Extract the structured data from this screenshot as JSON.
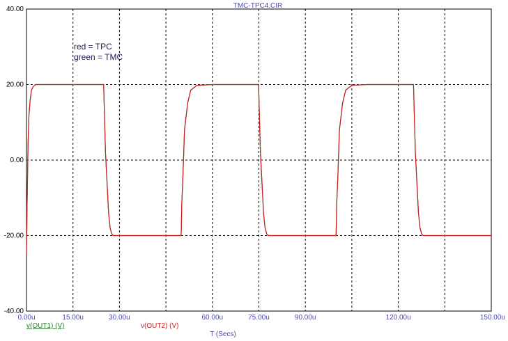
{
  "chart_data": {
    "type": "line",
    "title": "TMC-TPC4.CIR",
    "xlabel": "T (Secs)",
    "ylabel": "",
    "xlim": [
      0,
      150
    ],
    "ylim": [
      -40,
      40
    ],
    "x_ticks": [
      0,
      15,
      30,
      45,
      60,
      75,
      90,
      105,
      120,
      135,
      150
    ],
    "x_tick_labels": [
      "0.00u",
      "15.00u",
      "30.00u",
      "",
      "60.00u",
      "75.00u",
      "90.00u",
      "",
      "120.00u",
      "",
      "150.00u"
    ],
    "y_ticks": [
      -40,
      -20,
      0,
      20,
      40
    ],
    "y_tick_labels": [
      "-40.00",
      "-20.00",
      "0.00",
      "20.00",
      "40.00"
    ],
    "grid": true,
    "annotations": [
      "red = TPC",
      "green = TMC"
    ],
    "series": [
      {
        "name": "v(OUT1) (V)",
        "color": "#2a7a2a",
        "x": [
          0,
          0.2,
          0.5,
          0.8,
          1.2,
          1.6,
          2.2,
          3,
          5,
          10,
          20,
          24.9,
          25.0,
          25.1,
          25.5,
          26,
          26.5,
          27,
          27.5,
          28,
          30,
          40,
          49.9,
          50.0,
          50.1,
          50.5,
          51,
          52,
          53,
          55,
          60,
          70,
          74.9,
          75.0,
          75.1,
          75.5,
          76,
          76.5,
          77,
          77.5,
          78,
          80,
          90,
          99.9,
          100.0,
          100.1,
          100.5,
          101,
          102,
          103,
          105,
          110,
          120,
          124.9,
          125.0,
          125.1,
          125.5,
          126,
          126.5,
          127,
          127.5,
          128,
          130,
          140,
          150
        ],
        "y": [
          -25,
          -12,
          4,
          12,
          16,
          18.5,
          19.5,
          20,
          20,
          20,
          20,
          20,
          17,
          14,
          2,
          -6,
          -14,
          -18,
          -19.5,
          -20,
          -20,
          -20,
          -20,
          -17,
          -12,
          -4,
          8,
          15,
          18.5,
          19.8,
          20,
          20,
          20,
          17,
          14,
          2,
          -6,
          -14,
          -18,
          -19.5,
          -20,
          -20,
          -20,
          -20,
          -17,
          -12,
          -4,
          8,
          15,
          18.5,
          19.8,
          20,
          20,
          20,
          17,
          14,
          2,
          -6,
          -14,
          -18,
          -19.5,
          -20,
          -20,
          -20,
          -20
        ]
      },
      {
        "name": "v(OUT2) (V)",
        "color": "#cc2020",
        "x": [
          0,
          0.2,
          0.5,
          0.8,
          1.2,
          1.6,
          2.2,
          3,
          5,
          10,
          20,
          24.9,
          25.0,
          25.1,
          25.5,
          26,
          26.5,
          27,
          27.5,
          28,
          30,
          40,
          49.9,
          50.0,
          50.1,
          50.5,
          51,
          52,
          53,
          55,
          60,
          70,
          74.9,
          75.0,
          75.1,
          75.5,
          76,
          76.5,
          77,
          77.5,
          78,
          80,
          90,
          99.9,
          100.0,
          100.1,
          100.5,
          101,
          102,
          103,
          105,
          110,
          120,
          124.9,
          125.0,
          125.1,
          125.5,
          126,
          126.5,
          127,
          127.5,
          128,
          130,
          140,
          150
        ],
        "y": [
          -25,
          -12,
          4,
          12,
          16,
          18.5,
          19.5,
          20,
          20,
          20,
          20,
          20,
          17,
          14,
          2,
          -6,
          -14,
          -18,
          -19.5,
          -20,
          -20,
          -20,
          -20,
          -17,
          -12,
          -4,
          8,
          15,
          18.5,
          19.8,
          20,
          20,
          20,
          17,
          14,
          2,
          -6,
          -14,
          -18,
          -19.5,
          -20,
          -20,
          -20,
          -20,
          -17,
          -12,
          -4,
          8,
          15,
          18.5,
          19.8,
          20,
          20,
          20,
          17,
          14,
          2,
          -6,
          -14,
          -18,
          -19.5,
          -20,
          -20,
          -20,
          -20
        ]
      }
    ]
  }
}
